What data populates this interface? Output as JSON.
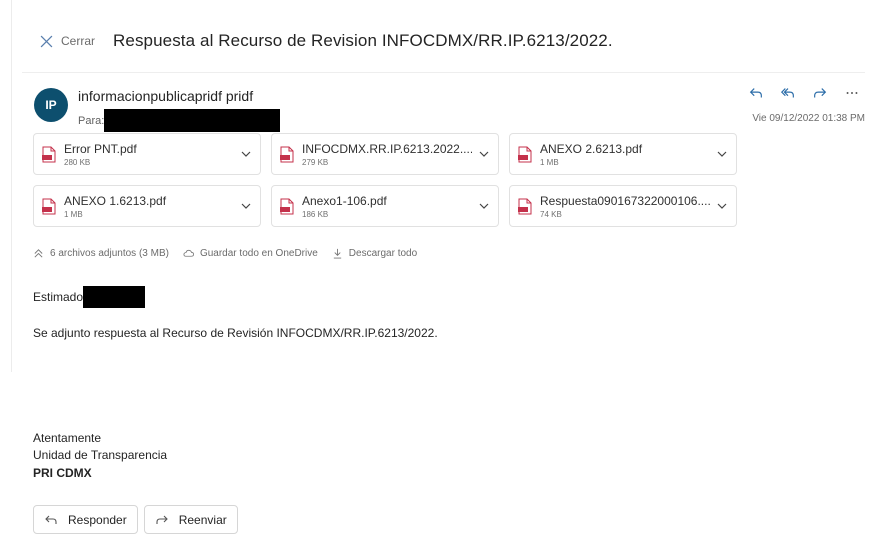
{
  "header": {
    "close_label": "Cerrar",
    "subject": "Respuesta al Recurso de Revision INFOCDMX/RR.IP.6213/2022."
  },
  "message": {
    "avatar_initials": "IP",
    "sender": "informacionpublicapridf pridf",
    "to_label": "Para:",
    "datetime": "Vie 09/12/2022 01:38 PM"
  },
  "attachments": [
    {
      "name": "Error PNT.pdf",
      "size": "280 KB"
    },
    {
      "name": "INFOCDMX.RR.IP.6213.2022....",
      "size": "279 KB"
    },
    {
      "name": "ANEXO 2.6213.pdf",
      "size": "1 MB"
    },
    {
      "name": "ANEXO 1.6213.pdf",
      "size": "1 MB"
    },
    {
      "name": "Anexo1-106.pdf",
      "size": "186 KB"
    },
    {
      "name": "Respuesta090167322000106....",
      "size": "74 KB"
    }
  ],
  "attachment_bar": {
    "summary": "6 archivos adjuntos (3 MB)",
    "save_onedrive": "Guardar todo en OneDrive",
    "download_all": "Descargar todo"
  },
  "body": {
    "greeting": "Estimado",
    "text": "Se adjunto respuesta al Recurso de Revisión INFOCDMX/RR.IP.6213/2022.",
    "signature_line1": "Atentamente",
    "signature_line2": "Unidad de Transparencia",
    "signature_line3": "PRI CDMX"
  },
  "buttons": {
    "reply": "Responder",
    "forward": "Reenviar"
  },
  "colors": {
    "avatar_bg": "#0d4f6e",
    "action_icons": "#2b6ca8",
    "pdf_icon": "#c4314b"
  }
}
